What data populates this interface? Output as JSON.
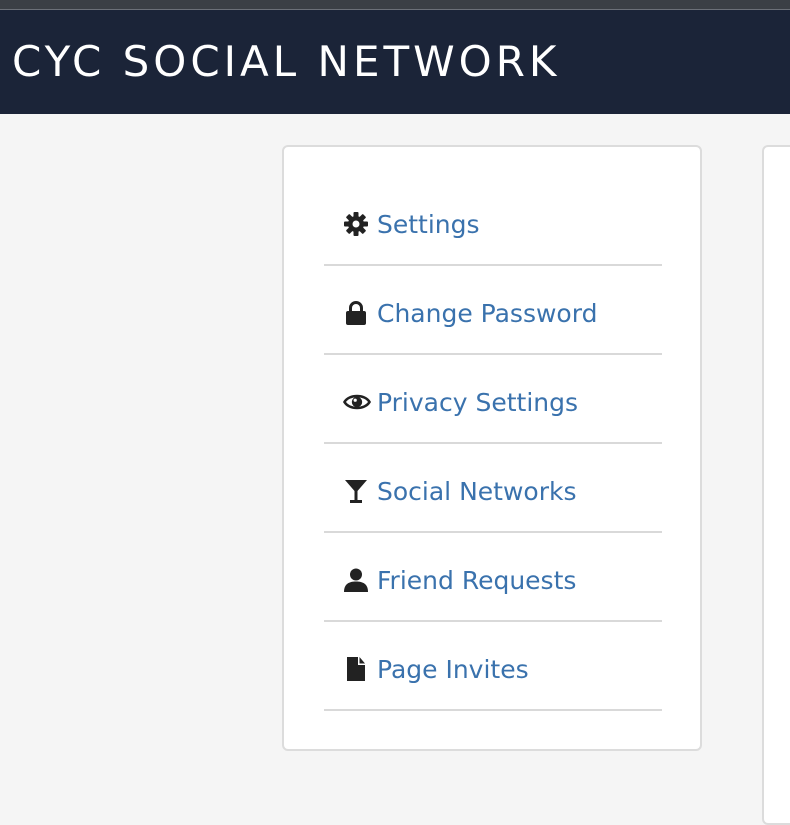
{
  "header": {
    "brand": "CYC SOCIAL NETWORK"
  },
  "settings_menu": {
    "items": [
      {
        "icon": "gear-icon",
        "label": "Settings"
      },
      {
        "icon": "lock-icon",
        "label": "Change Password"
      },
      {
        "icon": "eye-icon",
        "label": "Privacy Settings"
      },
      {
        "icon": "glass-icon",
        "label": "Social Networks"
      },
      {
        "icon": "user-icon",
        "label": "Friend Requests"
      },
      {
        "icon": "file-icon",
        "label": "Page Invites"
      }
    ]
  },
  "colors": {
    "navbar": "#1b2438",
    "link": "#3a72ad",
    "icon": "#222222",
    "background": "#f5f5f5"
  }
}
